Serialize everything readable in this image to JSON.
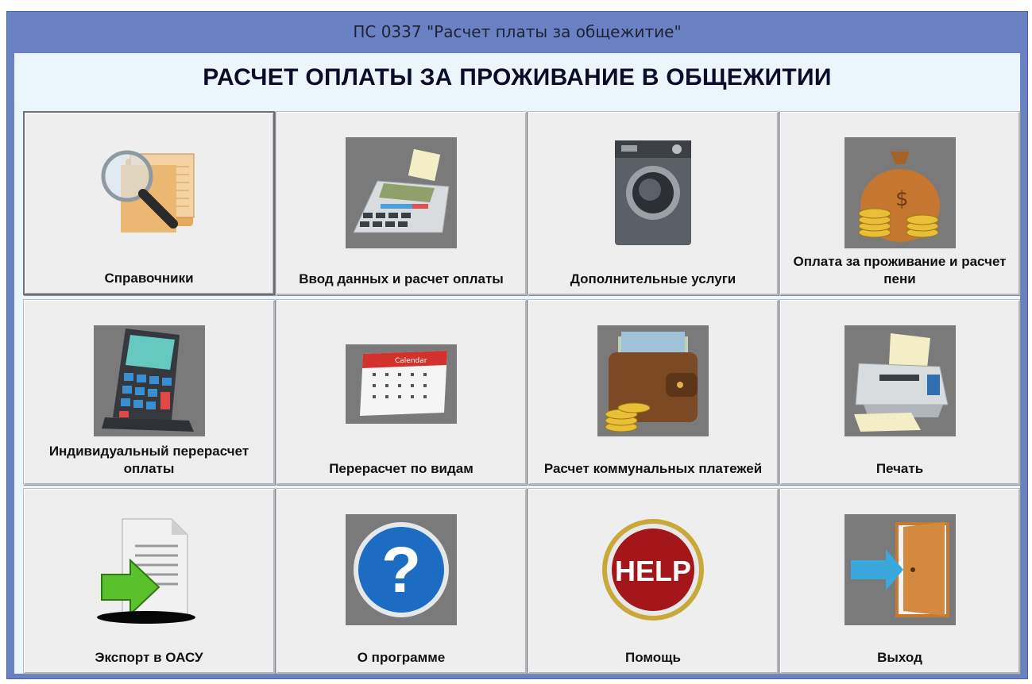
{
  "window": {
    "title": "ПС 0337 \"Расчет платы за общежитие\""
  },
  "heading": "РАСЧЕТ ОПЛАТЫ ЗА ПРОЖИВАНИЕ В ОБЩЕЖИТИИ",
  "tiles": [
    {
      "label": "Справочники",
      "icon": "folder-magnifier-icon"
    },
    {
      "label": "Ввод данных и расчет оплаты",
      "icon": "cash-register-icon"
    },
    {
      "label": "Дополнительные услуги",
      "icon": "washing-machine-icon"
    },
    {
      "label": "Оплата за проживание и расчет пени",
      "icon": "money-bag-icon"
    },
    {
      "label": "Индивидуальный перерасчет оплаты",
      "icon": "calculator-icon"
    },
    {
      "label": "Перерасчет по видам",
      "icon": "calendar-icon"
    },
    {
      "label": "Расчет коммунальных платежей",
      "icon": "wallet-icon"
    },
    {
      "label": "Печать",
      "icon": "printer-icon"
    },
    {
      "label": "Экспорт в ОАСУ",
      "icon": "export-document-icon"
    },
    {
      "label": "О программе",
      "icon": "question-icon"
    },
    {
      "label": "Помощь",
      "icon": "help-icon"
    },
    {
      "label": "Выход",
      "icon": "exit-door-icon"
    }
  ],
  "icon_texts": {
    "calendar": "Calendar",
    "help": "HELP",
    "question": "?"
  },
  "colors": {
    "title_bar": "#6a82c4",
    "client_bg": "#eaf6fb",
    "tile_bg": "#eeeeee"
  }
}
